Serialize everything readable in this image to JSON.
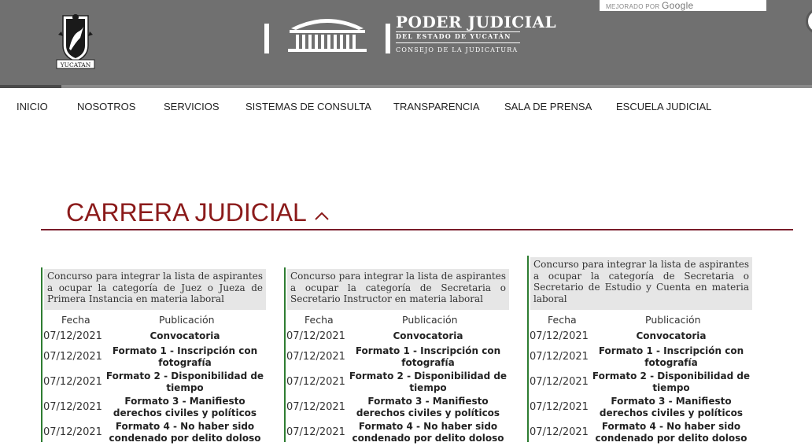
{
  "header": {
    "seal_text": "YUCATAN",
    "brand_line1": "PODER JUDICIAL",
    "brand_line2": "DEL ESTADO DE YUCATÁN",
    "brand_line3": "CONSEJO DE LA JUDICATURA",
    "search_label": "MEJORADO POR",
    "search_provider": "Google"
  },
  "nav": {
    "items": [
      "INICIO",
      "NOSOTROS",
      "SERVICIOS",
      "SISTEMAS DE CONSULTA",
      "TRANSPARENCIA",
      "SALA DE PRENSA",
      "ESCUELA JUDICIAL"
    ]
  },
  "section": {
    "title": "CARRERA JUDICIAL"
  },
  "colors": {
    "accent": "#8b1a1a",
    "header_bg": "#707070",
    "card_stripe": "#2e7d32"
  },
  "cards": [
    {
      "header": "Concurso para integrar la lista de aspirantes a ocupar la categoría de Juez o Jueza de Primera Instancia en materia laboral",
      "col_fecha": "Fecha",
      "col_publicacion": "Publicación",
      "rows": [
        {
          "date": "07/12/2021",
          "doc": "Convocatoria"
        },
        {
          "date": "07/12/2021",
          "doc": "Formato 1 - Inscripción con fotografía"
        },
        {
          "date": "07/12/2021",
          "doc": "Formato 2 - Disponibilidad de tiempo"
        },
        {
          "date": "07/12/2021",
          "doc": "Formato 3 - Manifiesto derechos civiles y políticos"
        },
        {
          "date": "07/12/2021",
          "doc": "Formato 4 - No haber sido condenado por delito doloso"
        }
      ]
    },
    {
      "header": "Concurso para integrar la lista de aspirantes a ocupar la categoría de Secretaria o Secretario Instructor en materia laboral",
      "col_fecha": "Fecha",
      "col_publicacion": "Publicación",
      "rows": [
        {
          "date": "07/12/2021",
          "doc": "Convocatoria"
        },
        {
          "date": "07/12/2021",
          "doc": "Formato 1 - Inscripción con fotografía"
        },
        {
          "date": "07/12/2021",
          "doc": "Formato 2 - Disponibilidad de tiempo"
        },
        {
          "date": "07/12/2021",
          "doc": "Formato 3 - Manifiesto derechos civiles y políticos"
        },
        {
          "date": "07/12/2021",
          "doc": "Formato 4 - No haber sido condenado por delito doloso"
        }
      ]
    },
    {
      "header": "Concurso para integrar la lista de aspirantes a ocupar la categoría de Secretaria o Secretario de Estudio y Cuenta en materia laboral",
      "col_fecha": "Fecha",
      "col_publicacion": "Publicación",
      "rows": [
        {
          "date": "07/12/2021",
          "doc": "Convocatoria"
        },
        {
          "date": "07/12/2021",
          "doc": "Formato 1 - Inscripción con fotografía"
        },
        {
          "date": "07/12/2021",
          "doc": "Formato 2 - Disponibilidad de tiempo"
        },
        {
          "date": "07/12/2021",
          "doc": "Formato 3 - Manifiesto derechos civiles y políticos"
        },
        {
          "date": "07/12/2021",
          "doc": "Formato 4 - No haber sido condenado por delito doloso"
        }
      ]
    }
  ]
}
